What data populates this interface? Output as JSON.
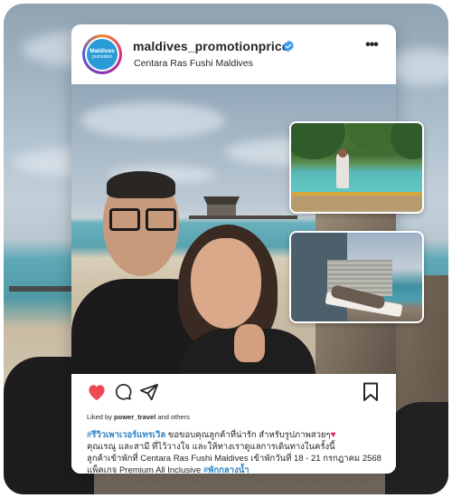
{
  "post": {
    "username": "maldives_promotionprice",
    "location": "Centara Ras Fushi Maldives",
    "avatar_text_line1": "Maldives",
    "avatar_text_line2": "promotion",
    "more_glyph": "•••"
  },
  "engagement": {
    "liked_by_prefix": "Liked by ",
    "liked_by_user": "power_travel",
    "liked_by_suffix": " and others"
  },
  "caption": {
    "hashtag1": "#รีวิวเพาเวอร์แทรเวิล",
    "line1_rest": " ขอขอบคุณลูกค้าที่น่ารัก สำหรับรูปภาพสวยๆ",
    "heart": "♥",
    "line2": "คุณเรณู และสามี ที่ไว้วางใจ และให้ทางเราดูแลการเดินทางในครั้งนี้",
    "line3": "ลูกค้าเข้าพักที่ Centara Ras Fushi Maldives เข้าพักวันที่ 18 - 21 กรกฎาคม 2568",
    "line4_prefix": "แพ็คเกจ Premium All Inclusive ",
    "hashtag2": "#พักกลางน้ำ"
  },
  "colors": {
    "verified": "#3897f0",
    "like": "#ed4956",
    "hashtag": "#2f84c7"
  },
  "icons": {
    "like": "heart-icon",
    "comment": "comment-icon",
    "share": "paper-plane-icon",
    "save": "bookmark-icon",
    "verified": "verified-badge-icon",
    "more": "more-options-icon"
  }
}
